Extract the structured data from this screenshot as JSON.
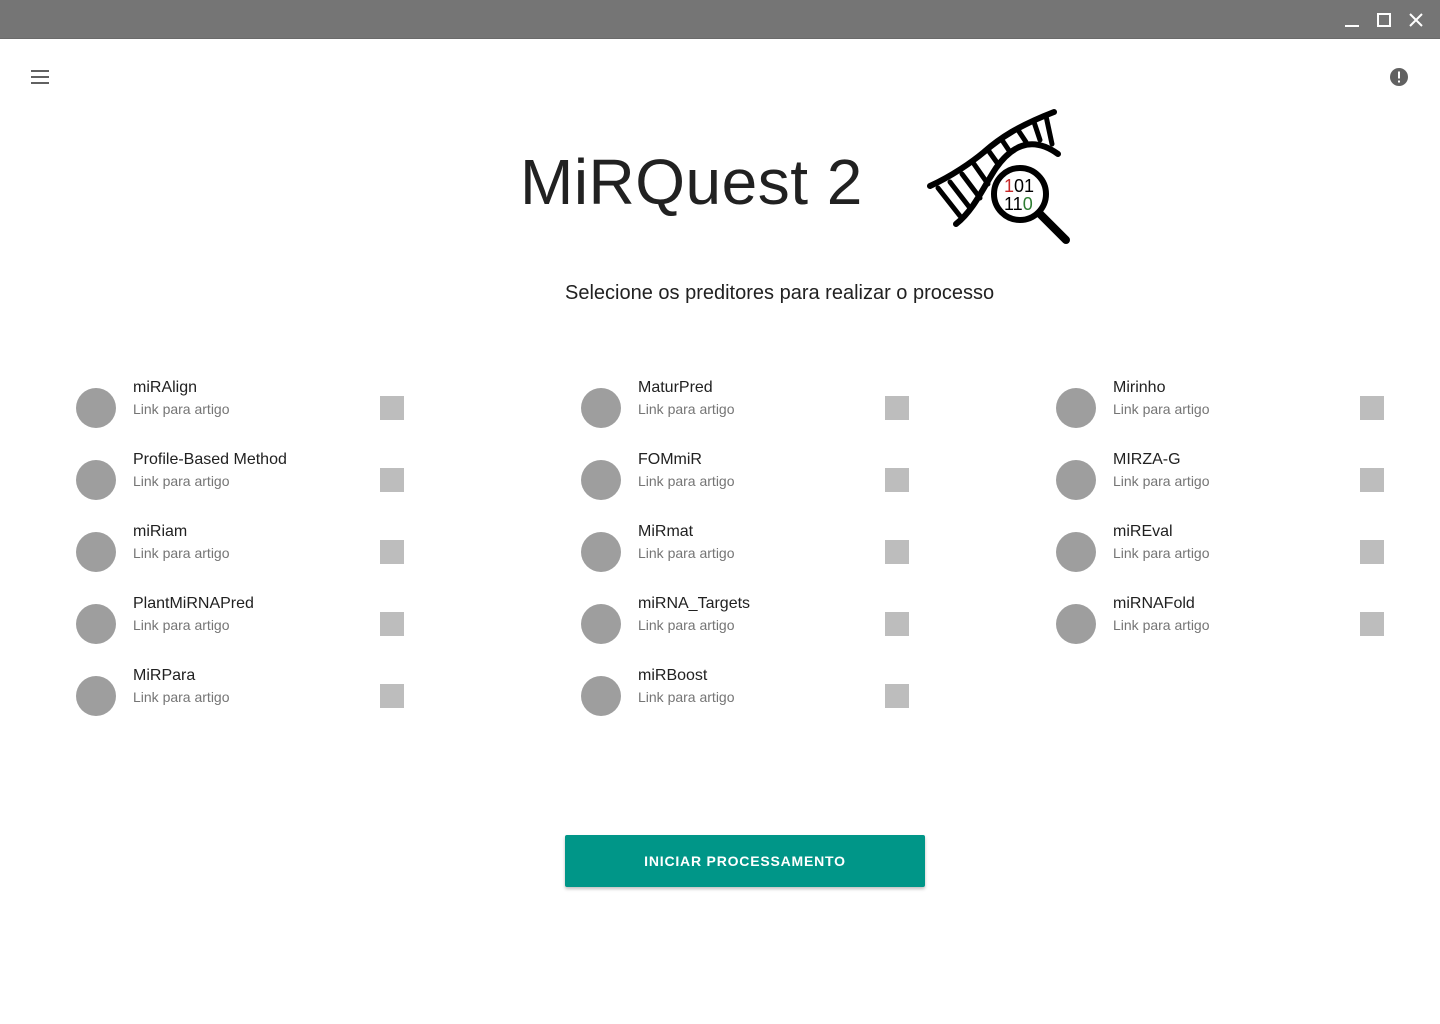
{
  "window": {
    "minimize_icon": "minimize-icon",
    "maximize_icon": "maximize-icon",
    "close_icon": "close-icon"
  },
  "toolbar": {
    "menu_icon": "hamburger-menu-icon",
    "alert_icon": "alert-circle-icon"
  },
  "header": {
    "title": "MiRQuest 2",
    "logo_digits_row1": [
      "1",
      "01"
    ],
    "logo_digits_row2": [
      "11",
      "0"
    ],
    "logo_colors": {
      "red": "#c62828",
      "green": "#2e7d32"
    }
  },
  "main": {
    "subtitle": "Selecione os preditores para realizar o processo",
    "predictors": [
      {
        "name": "miRAlign",
        "link": "Link para artigo",
        "checked": false
      },
      {
        "name": "Profile-Based Method",
        "link": "Link para artigo",
        "checked": false
      },
      {
        "name": "miRiam",
        "link": "Link para artigo",
        "checked": false
      },
      {
        "name": "PlantMiRNAPred",
        "link": "Link para artigo",
        "checked": false
      },
      {
        "name": "MiRPara",
        "link": "Link para artigo",
        "checked": false
      },
      {
        "name": "MaturPred",
        "link": "Link para artigo",
        "checked": false
      },
      {
        "name": "FOMmiR",
        "link": "Link para artigo",
        "checked": false
      },
      {
        "name": "MiRmat",
        "link": "Link para artigo",
        "checked": false
      },
      {
        "name": "miRNA_Targets",
        "link": "Link para artigo",
        "checked": false
      },
      {
        "name": "miRBoost",
        "link": "Link para artigo",
        "checked": false
      },
      {
        "name": "Mirinho",
        "link": "Link para artigo",
        "checked": false
      },
      {
        "name": "MIRZA-G",
        "link": "Link para artigo",
        "checked": false
      },
      {
        "name": "miREval",
        "link": "Link para artigo",
        "checked": false
      },
      {
        "name": "miRNAFold",
        "link": "Link para artigo",
        "checked": false
      }
    ],
    "start_button": "INICIAR PROCESSAMENTO"
  },
  "colors": {
    "titlebar": "#757575",
    "accent": "#009688",
    "avatar": "#9e9e9e",
    "checkbox": "#bdbdbd"
  }
}
